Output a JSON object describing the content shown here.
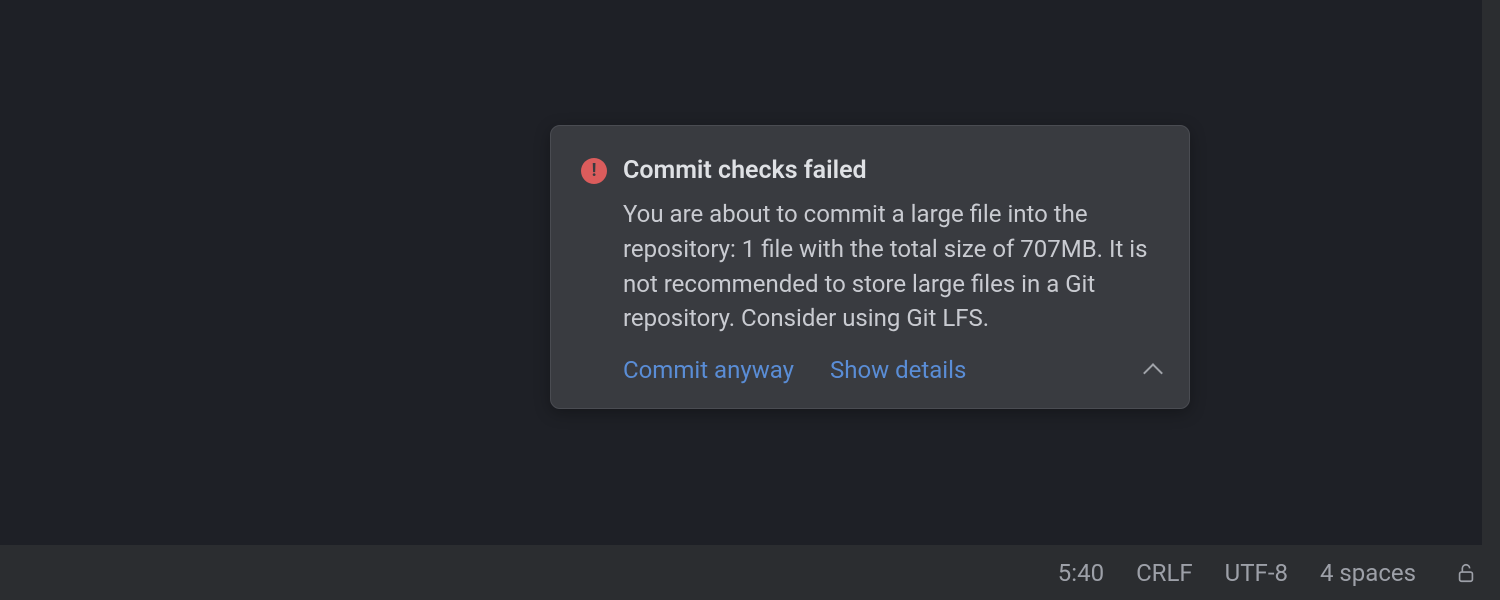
{
  "notification": {
    "title": "Commit checks failed",
    "body": "You are about to commit a large file into the repository: 1 file with the total size of 707MB. It is not recommended to store large files in a Git repository. Consider using Git LFS.",
    "actions": {
      "commit_anyway": "Commit anyway",
      "show_details": "Show details"
    }
  },
  "status_bar": {
    "cursor_position": "5:40",
    "line_ending": "CRLF",
    "encoding": "UTF-8",
    "indent": "4 spaces"
  }
}
